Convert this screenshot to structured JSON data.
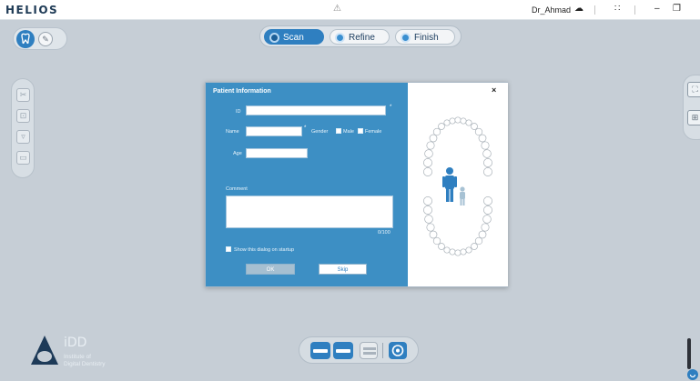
{
  "titlebar": {
    "logo": "HELIOS",
    "center_icon": "⚠",
    "user": "Dr_Ahmad",
    "icons": {
      "cloud": "☁",
      "grid": "∷",
      "minimize": "–",
      "restore": "❐"
    }
  },
  "stepper": {
    "steps": [
      {
        "label": "Scan",
        "active": true
      },
      {
        "label": "Refine",
        "active": false
      },
      {
        "label": "Finish",
        "active": false
      }
    ]
  },
  "dialog": {
    "title": "Patient Information",
    "id_label": "ID",
    "id_value": "",
    "required_mark": "*",
    "name_label": "Name",
    "name_value": "",
    "gender_label": "Gender",
    "male_label": "Male",
    "female_label": "Female",
    "age_label": "Age",
    "age_value": "",
    "comment_label": "Comment",
    "comment_value": "",
    "char_count": "0/100",
    "show_on_startup_label": "Show this dialog on startup",
    "ok_label": "OK",
    "skip_label": "Skip",
    "close_label": "×"
  },
  "branding": {
    "name": "iDD",
    "subtitle_line1": "Institute of",
    "subtitle_line2": "Digital Dentistry"
  },
  "colors": {
    "accent": "#2f7fc0",
    "dialog_blue": "#3d8fc4",
    "background": "#c6ced6"
  }
}
